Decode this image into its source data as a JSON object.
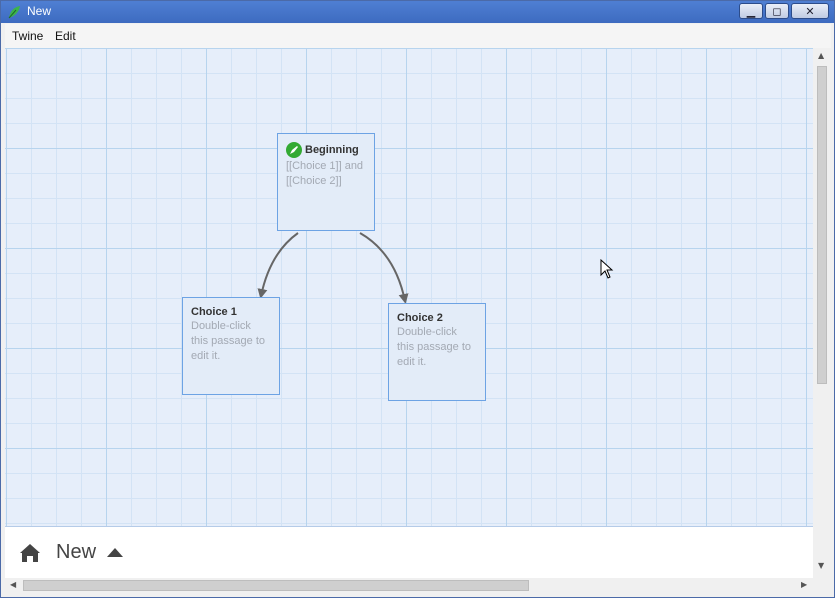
{
  "window": {
    "title": "New",
    "minimize_label": "▁",
    "maximize_label": "◻",
    "close_label": "✕"
  },
  "menu": {
    "items": [
      "Twine",
      "Edit"
    ]
  },
  "passages": [
    {
      "title": "Beginning",
      "excerpt": "[[Choice 1]] and [[Choice 2]]",
      "start": true
    },
    {
      "title": "Choice 1",
      "excerpt": "Double-click this passage to edit it.",
      "start": false
    },
    {
      "title": "Choice 2",
      "excerpt": "Double-click this passage to edit it.",
      "start": false
    }
  ],
  "links": [
    {
      "from": "Beginning",
      "to": "Choice 1"
    },
    {
      "from": "Beginning",
      "to": "Choice 2"
    }
  ],
  "footer": {
    "story_name": "New"
  },
  "colors": {
    "titlebar": "#4576cc",
    "passage_border": "#6da3e4",
    "start_badge": "#33aa33"
  },
  "icons": {
    "app": "twine-leaf-icon",
    "home": "home-icon",
    "story_menu": "caret-up-icon",
    "start": "rocket-icon"
  }
}
